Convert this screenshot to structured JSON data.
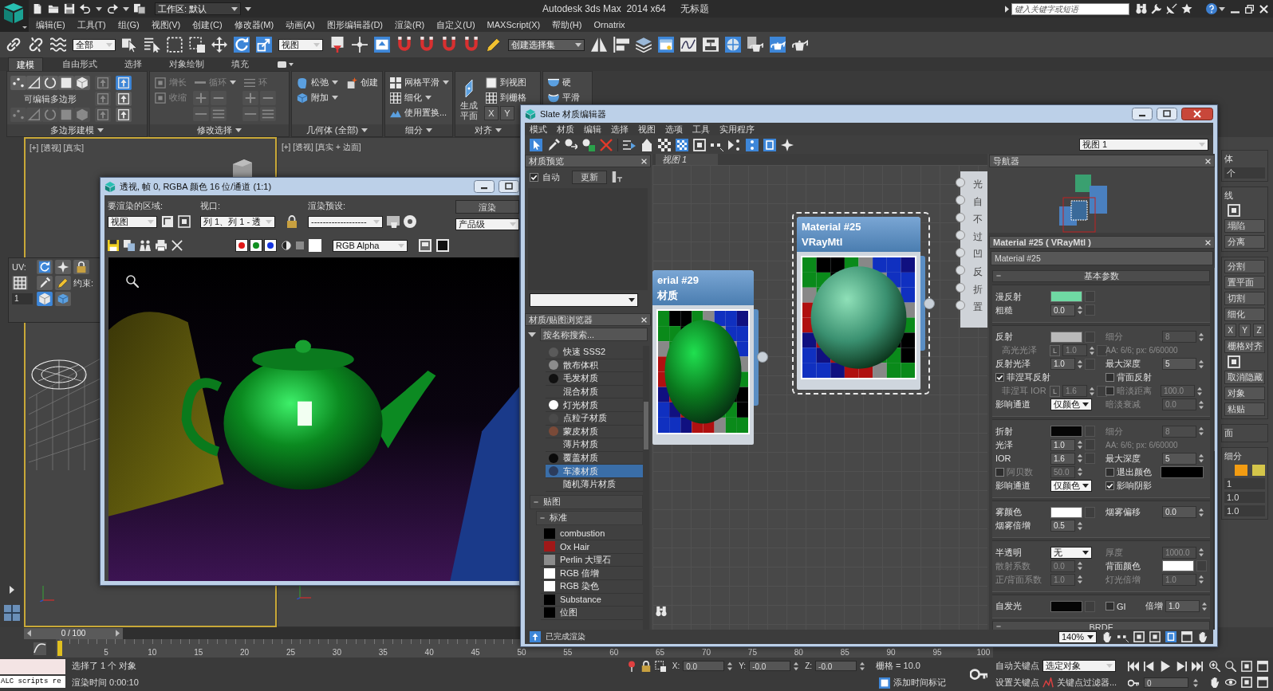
{
  "title_bar": {
    "workspace": "工作区: 默认",
    "title": "Autodesk 3ds Max  2014 x64",
    "document": "无标题",
    "search": {
      "placeholder": "键入关键字或短语"
    }
  },
  "menu_bar": [
    "编辑(E)",
    "工具(T)",
    "组(G)",
    "视图(V)",
    "创建(C)",
    "修改器(M)",
    "动画(A)",
    "图形编辑器(D)",
    "渲染(R)",
    "自定义(U)",
    "MAXScript(X)",
    "帮助(H)",
    "Ornatrix"
  ],
  "main_toolbar": {
    "selection_filter": "全部",
    "coordinate_system": "视图",
    "selection_set": "创建选择集"
  },
  "ribbon": {
    "tabs": [
      {
        "label": "建模",
        "selected": true
      },
      {
        "label": "自由形式",
        "selected": false
      },
      {
        "label": "选择",
        "selected": false
      },
      {
        "label": "对象绘制",
        "selected": false
      },
      {
        "label": "填充",
        "selected": false
      }
    ],
    "panels": [
      {
        "title": "多边形建模",
        "columns": [
          [
            {
              "kind": "tools",
              "disabled": false
            },
            {
              "kind": "text",
              "label": "可编辑多边形"
            },
            {
              "kind": "tools",
              "disabled": true
            }
          ],
          [
            {
              "kind": "icon",
              "disabled": true,
              "on": false
            },
            {
              "kind": "icon",
              "disabled": true,
              "on": false
            },
            {
              "kind": "icon",
              "disabled": true,
              "on": false
            }
          ],
          [
            {
              "kind": "icon",
              "disabled": false,
              "on": true
            },
            {
              "kind": "icon",
              "disabled": false,
              "on": false
            },
            {
              "kind": "icon",
              "disabled": false,
              "on": false
            }
          ]
        ]
      },
      {
        "title": "修改选择",
        "columns": [
          [
            {
              "kind": "button",
              "label": "增长",
              "dropdown": false,
              "disabled": true
            },
            {
              "kind": "button",
              "label": "收缩",
              "dropdown": false,
              "disabled": true
            }
          ],
          [
            {
              "kind": "button",
              "label": "循环",
              "dropdown": true,
              "disabled": true
            },
            {
              "kind": "plus_minus",
              "disabled": true
            },
            {
              "kind": "pair",
              "disabled": true
            }
          ],
          [
            {
              "kind": "button",
              "label": "环",
              "dropdown": false,
              "disabled": true
            },
            {
              "kind": "plus_minus",
              "disabled": true
            },
            {
              "kind": "pair",
              "disabled": true
            }
          ]
        ]
      },
      {
        "title": "几何体 (全部)",
        "columns": [
          [
            {
              "kind": "button",
              "label": "松弛",
              "dropdown": true,
              "disabled": false
            },
            {
              "kind": "button",
              "label": "附加",
              "dropdown": true,
              "disabled": false
            }
          ],
          [
            {
              "kind": "button",
              "label": "创建",
              "dropdown": false,
              "disabled": false
            }
          ]
        ]
      },
      {
        "title": "细分",
        "columns": [
          [
            {
              "kind": "button",
              "label": "网格平滑",
              "dropdown": true,
              "disabled": false
            },
            {
              "kind": "button",
              "label": "细化",
              "dropdown": true,
              "disabled": false
            },
            {
              "kind": "button",
              "label": "使用置换...",
              "dropdown": false,
              "disabled": false
            }
          ]
        ]
      },
      {
        "title": "对齐",
        "columns": [
          [
            {
              "kind": "big",
              "label": "生成平面"
            }
          ],
          [
            {
              "kind": "button",
              "label": "到视图",
              "dropdown": false,
              "disabled": false
            },
            {
              "kind": "button",
              "label": "到栅格",
              "dropdown": false,
              "disabled": false
            },
            {
              "kind": "axes",
              "labels": [
                "X",
                "Y"
              ]
            }
          ]
        ]
      },
      {
        "columns": [
          [
            {
              "kind": "button",
              "label": "硬",
              "dropdown": false,
              "disabled": false
            },
            {
              "kind": "button",
              "label": "平滑",
              "dropdown": false,
              "disabled": false
            }
          ]
        ]
      }
    ]
  },
  "viewports": [
    {
      "label": "[+] [透视] [真实]",
      "active": true
    },
    {
      "label": "[+] [透视] [真实 + 边面]",
      "active": false
    }
  ],
  "uv_panel": {
    "uv_label": "UV:",
    "constraint_label": "约束:",
    "value": "1"
  },
  "render_window": {
    "title": "透视, 帧 0, RGBA 颜色 16 位/通道 (1:1)",
    "area": {
      "label": "要渲染的区域:",
      "value": "视图"
    },
    "viewport": {
      "label": "视口:",
      "value": "列 1、列 1 - 透"
    },
    "preset": {
      "label": "渲染预设:",
      "value": "-------------------"
    },
    "render_button": "渲染",
    "quality": "产品级",
    "channels": [
      {
        "color": "#e01818",
        "on": true
      },
      {
        "color": "#0f8f1f",
        "on": true
      },
      {
        "color": "#1434e0",
        "on": true
      }
    ],
    "display": "RGB Alpha"
  },
  "slate_editor": {
    "title": "Slate 材质编辑器",
    "menu": [
      "模式",
      "材质",
      "编辑",
      "选择",
      "视图",
      "选项",
      "工具",
      "实用程序"
    ],
    "view_select": "视图 1",
    "preview": {
      "title": "材质预览",
      "auto": {
        "label": "自动",
        "checked": true
      },
      "update": "更新"
    },
    "browser": {
      "title": "材质/贴图浏览器",
      "search": {
        "placeholder": "按名称搜索..."
      },
      "materials": [
        {
          "label": "快速 SSS2",
          "color": "#5a5a5a",
          "selected": false
        },
        {
          "label": "散布体积",
          "color": "#8c8c8c",
          "selected": false
        },
        {
          "label": "毛发材质",
          "color": "#111111",
          "selected": false
        },
        {
          "label": "混合材质",
          "selected": false
        },
        {
          "label": "灯光材质",
          "color": "#ffffff",
          "selected": false
        },
        {
          "label": "点粒子材质",
          "color": "#4a4a4a",
          "selected": false
        },
        {
          "label": "蒙皮材质",
          "color": "#7a4a38",
          "selected": false
        },
        {
          "label": "薄片材质",
          "selected": false
        },
        {
          "label": "覆盖材质",
          "color": "#0a0a0a",
          "selected": false
        },
        {
          "label": "车漆材质",
          "color": "#2c3c5c",
          "selected": true
        },
        {
          "label": "随机薄片材质",
          "selected": false
        }
      ],
      "groups": [
        {
          "label": "贴图",
          "expanded": true,
          "children": [
            {
              "label": "标准",
              "expanded": true,
              "children": [
                {
                  "label": "combustion",
                  "color": "#000000"
                },
                {
                  "label": "Ox Hair",
                  "color": "#a01818"
                },
                {
                  "label": "Perlin 大理石",
                  "color": "#8c8c8c"
                },
                {
                  "label": "RGB 倍增",
                  "color": "#ffffff"
                },
                {
                  "label": "RGB 染色",
                  "color": "#ffffff"
                },
                {
                  "label": "Substance",
                  "color": "#000000"
                },
                {
                  "label": "位图",
                  "color": "#000000"
                }
              ]
            }
          ]
        }
      ]
    },
    "view_tab": "视图 1",
    "nodes": [
      {
        "title": "erial #29",
        "subtitle": "材质",
        "selected": false
      },
      {
        "title": "Material #25",
        "subtitle": "VRayMtl",
        "selected": true
      }
    ],
    "slots": [
      "光",
      "自",
      "不",
      "过",
      "凹",
      "反",
      "折",
      "置"
    ],
    "navigator": "导航器",
    "params": {
      "title": "Material #25 ( VRayMtl )",
      "name": "Material #25",
      "rollouts": [
        {
          "title": "基本参数",
          "expanded": true,
          "sections": [
            [
              [
                {
                  "kind": "color",
                  "label": "漫反射",
                  "color": "#6fd9a3",
                  "map_slot": true
                }
              ],
              [
                {
                  "kind": "spinner",
                  "label": "粗糙",
                  "value": "0.0",
                  "disabled": false,
                  "map_slot": true
                }
              ]
            ],
            [
              [
                {
                  "kind": "color",
                  "label": "反射",
                  "color": "#b9b9b9",
                  "map_slot": true
                },
                {
                  "kind": "spinner",
                  "label": "细分",
                  "value": "8",
                  "disabled": true
                }
              ],
              [
                {
                  "kind": "spinner",
                  "label": "高光光泽",
                  "value": "1.0",
                  "disabled": true,
                  "lock_button": "L",
                  "map_slot": true
                },
                {
                  "kind": "note",
                  "label": "AA: 6/6; px: 6/60000",
                  "disabled": true
                }
              ],
              [
                {
                  "kind": "spinner",
                  "label": "反射光泽",
                  "value": "1.0",
                  "disabled": false,
                  "map_slot": true
                },
                {
                  "kind": "spinner",
                  "label": "最大深度",
                  "value": "5",
                  "disabled": false
                }
              ],
              [
                {
                  "kind": "check",
                  "label": "菲涅耳反射",
                  "checked": true
                },
                {
                  "kind": "check",
                  "label": "背面反射",
                  "checked": false
                }
              ],
              [
                {
                  "kind": "spinner",
                  "label": "菲涅耳 IOR",
                  "value": "1.6",
                  "disabled": true,
                  "lock_button": "L",
                  "map_slot": true
                },
                {
                  "kind": "check_spinner",
                  "label": "暗淡距离",
                  "checked": false,
                  "value": "100.0",
                  "disabled": true
                }
              ],
              [
                {
                  "kind": "dropdown",
                  "label": "影响通道",
                  "value": "仅颜色"
                },
                {
                  "kind": "spinner",
                  "label": "暗淡衰减",
                  "value": "0.0",
                  "disabled": true
                }
              ]
            ],
            [
              [
                {
                  "kind": "color",
                  "label": "折射",
                  "color": "#050505",
                  "map_slot": true
                },
                {
                  "kind": "spinner",
                  "label": "细分",
                  "value": "8",
                  "disabled": true
                }
              ],
              [
                {
                  "kind": "spinner",
                  "label": "光泽",
                  "value": "1.0",
                  "disabled": false,
                  "map_slot": true
                },
                {
                  "kind": "note",
                  "label": "AA: 6/6; px: 6/60000",
                  "disabled": true
                }
              ],
              [
                {
                  "kind": "spinner",
                  "label": "IOR",
                  "value": "1.6",
                  "disabled": false,
                  "map_slot": true
                },
                {
                  "kind": "spinner",
                  "label": "最大深度",
                  "value": "5",
                  "disabled": false
                }
              ],
              [
                {
                  "kind": "check_spinner",
                  "label": "阿贝数",
                  "checked": false,
                  "value": "50.0",
                  "disabled": true
                },
                {
                  "kind": "check_color",
                  "label": "退出颜色",
                  "checked": false,
                  "color": "#000000"
                }
              ],
              [
                {
                  "kind": "dropdown",
                  "label": "影响通道",
                  "value": "仅颜色"
                },
                {
                  "kind": "check",
                  "label": "影响阴影",
                  "checked": true
                }
              ]
            ],
            [
              [
                {
                  "kind": "color",
                  "label": "雾颜色",
                  "color": "#ffffff",
                  "map_slot": true
                },
                {
                  "kind": "spinner",
                  "label": "烟雾偏移",
                  "value": "0.0",
                  "disabled": false
                }
              ],
              [
                {
                  "kind": "spinner",
                  "label": "烟雾倍增",
                  "value": "0.5",
                  "disabled": false
                }
              ]
            ],
            [
              [
                {
                  "kind": "dropdown",
                  "label": "半透明",
                  "value": "无"
                },
                {
                  "kind": "spinner",
                  "label": "厚度",
                  "value": "1000.0",
                  "disabled": true
                }
              ],
              [
                {
                  "kind": "spinner",
                  "label": "散射系数",
                  "value": "0.0",
                  "disabled": true
                },
                {
                  "kind": "color",
                  "label": "背面颜色",
                  "color": "#ffffff",
                  "map_slot": true
                }
              ],
              [
                {
                  "kind": "spinner",
                  "label": "正/背面系数",
                  "value": "1.0",
                  "disabled": true
                },
                {
                  "kind": "spinner",
                  "label": "灯光倍增",
                  "value": "1.0",
                  "disabled": true
                }
              ]
            ],
            [
              [
                {
                  "kind": "color",
                  "label": "自发光",
                  "color": "#050505",
                  "map_slot": true
                },
                {
                  "kind": "check",
                  "label": "GI",
                  "checked": false
                },
                {
                  "kind": "spinner",
                  "label": "倍增",
                  "value": "1.0",
                  "disabled": false
                }
              ]
            ]
          ]
        },
        {
          "title": "BRDF",
          "expanded": true
        }
      ]
    },
    "status": "已完成渲染",
    "zoom": "140%"
  },
  "command_panel": {
    "groups": [
      [
        {
          "kind": "label",
          "label": "体"
        },
        {
          "kind": "field",
          "value": "个"
        }
      ],
      [
        {
          "kind": "label",
          "label": "线"
        },
        {
          "kind": "icon"
        },
        {
          "kind": "button",
          "label": "塌陷"
        },
        {
          "kind": "button",
          "label": "分离"
        }
      ],
      [
        {
          "kind": "button",
          "label": "分割"
        },
        {
          "kind": "button",
          "label": "置平面"
        },
        {
          "kind": "button",
          "label": "切割"
        },
        {
          "kind": "button",
          "label": "细化"
        },
        {
          "kind": "axes",
          "labels": [
            "X",
            "Y",
            "Z"
          ]
        },
        {
          "kind": "button",
          "label": "栅格对齐"
        },
        {
          "kind": "icon"
        },
        {
          "kind": "button",
          "label": "取消隐藏"
        },
        {
          "kind": "button",
          "label": "对象"
        },
        {
          "kind": "button",
          "label": "粘贴"
        }
      ],
      [
        {
          "kind": "label",
          "label": "面"
        }
      ],
      [
        {
          "kind": "label",
          "label": "细分"
        },
        {
          "kind": "swatches",
          "items": [
            {
              "color": "#f39c12"
            },
            {
              "color": "#d4c54a"
            }
          ]
        },
        {
          "kind": "field",
          "value": "1"
        },
        {
          "kind": "field",
          "value": "1.0"
        },
        {
          "kind": "field",
          "value": "1.0"
        }
      ]
    ]
  },
  "timeline": {
    "frame": "0 / 100",
    "level": 0,
    "ticks": [
      "5",
      "10",
      "15",
      "20",
      "25",
      "30",
      "35",
      "40",
      "45",
      "50",
      "55",
      "60",
      "65",
      "70",
      "75",
      "80",
      "85",
      "90",
      "95",
      "100"
    ]
  },
  "status_bar": {
    "listener": "ALC scripts re",
    "prompt": "选择了 1 个 对象",
    "render_time": "渲染时间 0:00:10",
    "x": {
      "label": "X:",
      "value": "0.0"
    },
    "y": {
      "label": "Y:",
      "value": "-0.0"
    },
    "z": {
      "label": "Z:",
      "value": "-0.0"
    },
    "grid": "栅格 = 10.0",
    "time_tag": "添加时间标记",
    "auto_key": "自动关键点",
    "key_mode": "选定对象",
    "set_key": "设置关键点",
    "key_filters": "关键点过滤器...",
    "frame": "0"
  }
}
